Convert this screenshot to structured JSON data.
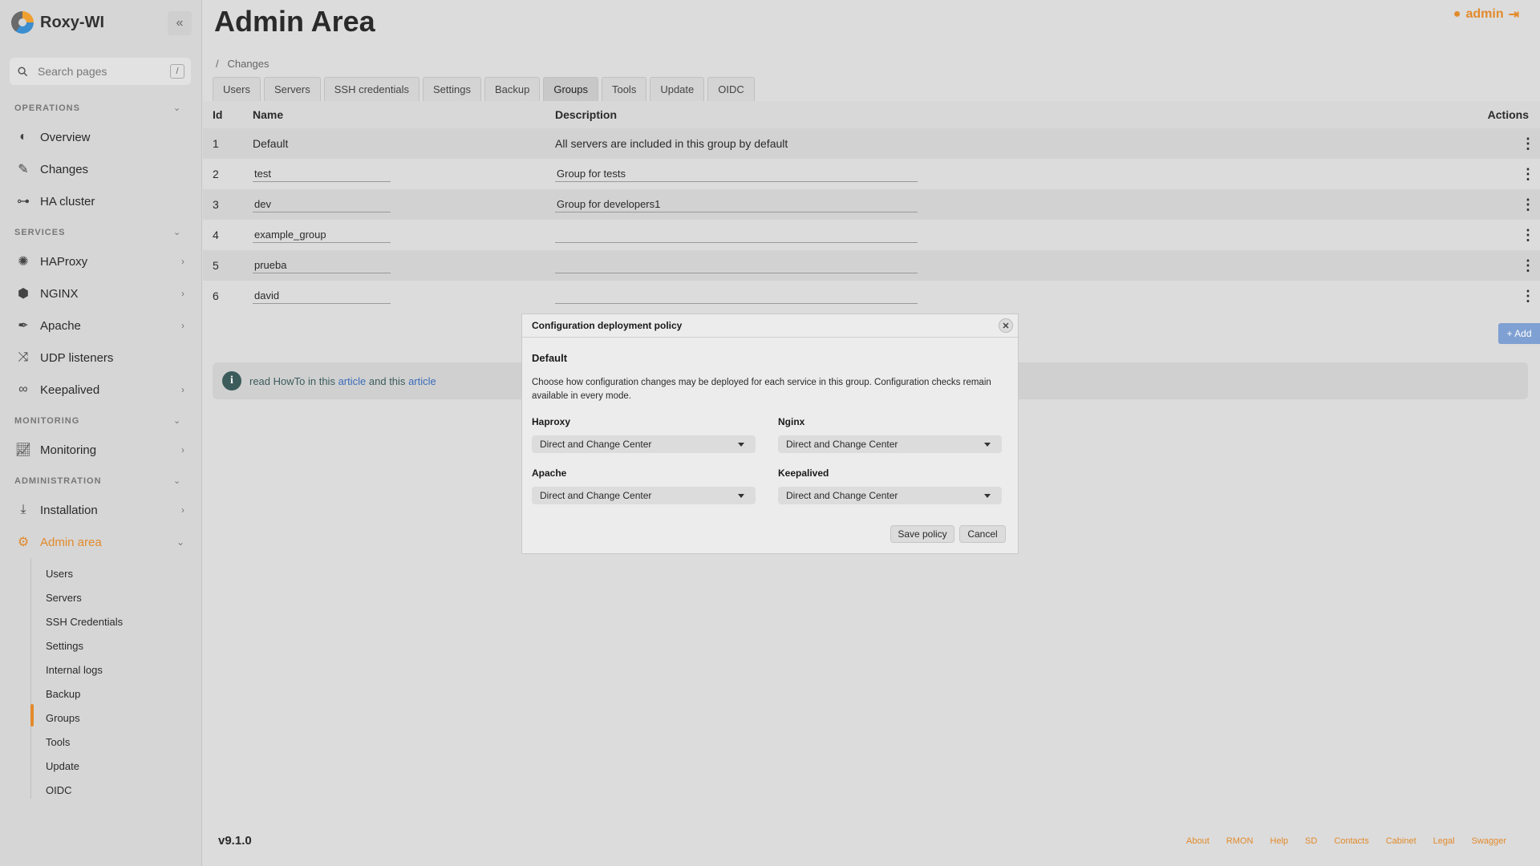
{
  "app": {
    "name": "Roxy-WI",
    "collapse_label": "«"
  },
  "search": {
    "placeholder": "Search pages",
    "shortcut": "/"
  },
  "sidebar": {
    "sections": {
      "operations": "OPERATIONS",
      "services": "SERVICES",
      "monitoring": "MONITORING",
      "administration": "ADMINISTRATION"
    },
    "items": {
      "overview": "Overview",
      "changes": "Changes",
      "ha_cluster": "HA cluster",
      "haproxy": "HAProxy",
      "nginx": "NGINX",
      "apache": "Apache",
      "udp": "UDP listeners",
      "keepalived": "Keepalived",
      "monitoring": "Monitoring",
      "installation": "Installation",
      "admin_area": "Admin area"
    },
    "admin_sub": [
      "Users",
      "Servers",
      "SSH Credentials",
      "Settings",
      "Internal logs",
      "Backup",
      "Groups",
      "Tools",
      "Update",
      "OIDC"
    ],
    "active_sub": "Groups"
  },
  "header": {
    "title": "Admin Area",
    "user": "admin"
  },
  "breadcrumb": {
    "separator": "/",
    "current": "Changes"
  },
  "tabs": [
    "Users",
    "Servers",
    "SSH credentials",
    "Settings",
    "Backup",
    "Groups",
    "Tools",
    "Update",
    "OIDC"
  ],
  "active_tab": "Groups",
  "table": {
    "headers": {
      "id": "Id",
      "name": "Name",
      "description": "Description",
      "actions": "Actions"
    },
    "rows": [
      {
        "id": "1",
        "name": "Default",
        "description": "All servers are included in this group by default"
      },
      {
        "id": "2",
        "name": "test",
        "description": "Group for tests"
      },
      {
        "id": "3",
        "name": "dev",
        "description": "Group for developers1"
      },
      {
        "id": "4",
        "name": "example_group",
        "description": ""
      },
      {
        "id": "5",
        "name": "prueba",
        "description": ""
      },
      {
        "id": "6",
        "name": "david",
        "description": ""
      }
    ]
  },
  "add_button": "+ Add",
  "info": {
    "prefix": "read HowTo in this",
    "link1": "article",
    "middle": "and this",
    "link2": "article"
  },
  "modal": {
    "title": "Configuration deployment policy",
    "close": "✕",
    "group": "Default",
    "description": "Choose how configuration changes may be deployed for each service in this group. Configuration checks remain available in every mode.",
    "fields": {
      "haproxy": {
        "label": "Haproxy",
        "value": "Direct and Change Center"
      },
      "nginx": {
        "label": "Nginx",
        "value": "Direct and Change Center"
      },
      "apache": {
        "label": "Apache",
        "value": "Direct and Change Center"
      },
      "keepalived": {
        "label": "Keepalived",
        "value": "Direct and Change Center"
      }
    },
    "save": "Save policy",
    "cancel": "Cancel"
  },
  "footer": {
    "version": "v9.1.0",
    "links": [
      "About",
      "RMON",
      "Help",
      "SD",
      "Contacts",
      "Cabinet",
      "Legal",
      "Swagger"
    ]
  },
  "colors": {
    "accent": "#e28a2b",
    "link": "#3b6dba",
    "add_button": "#7fa0d2"
  }
}
